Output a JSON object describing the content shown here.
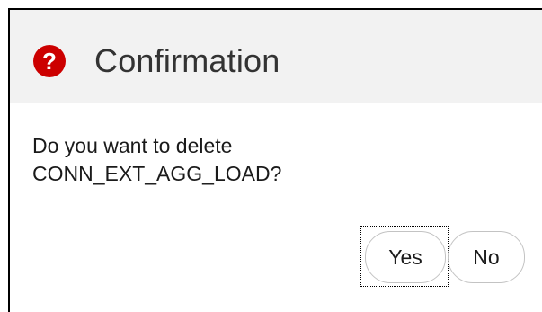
{
  "dialog": {
    "title": "Confirmation",
    "icon": "help-icon",
    "icon_glyph": "?",
    "icon_color": "#cc0000",
    "message_line1": "Do you want to delete",
    "message_line2": "CONN_EXT_AGG_LOAD?",
    "buttons": {
      "yes_label": "Yes",
      "no_label": "No"
    },
    "focused_button": "Yes"
  }
}
